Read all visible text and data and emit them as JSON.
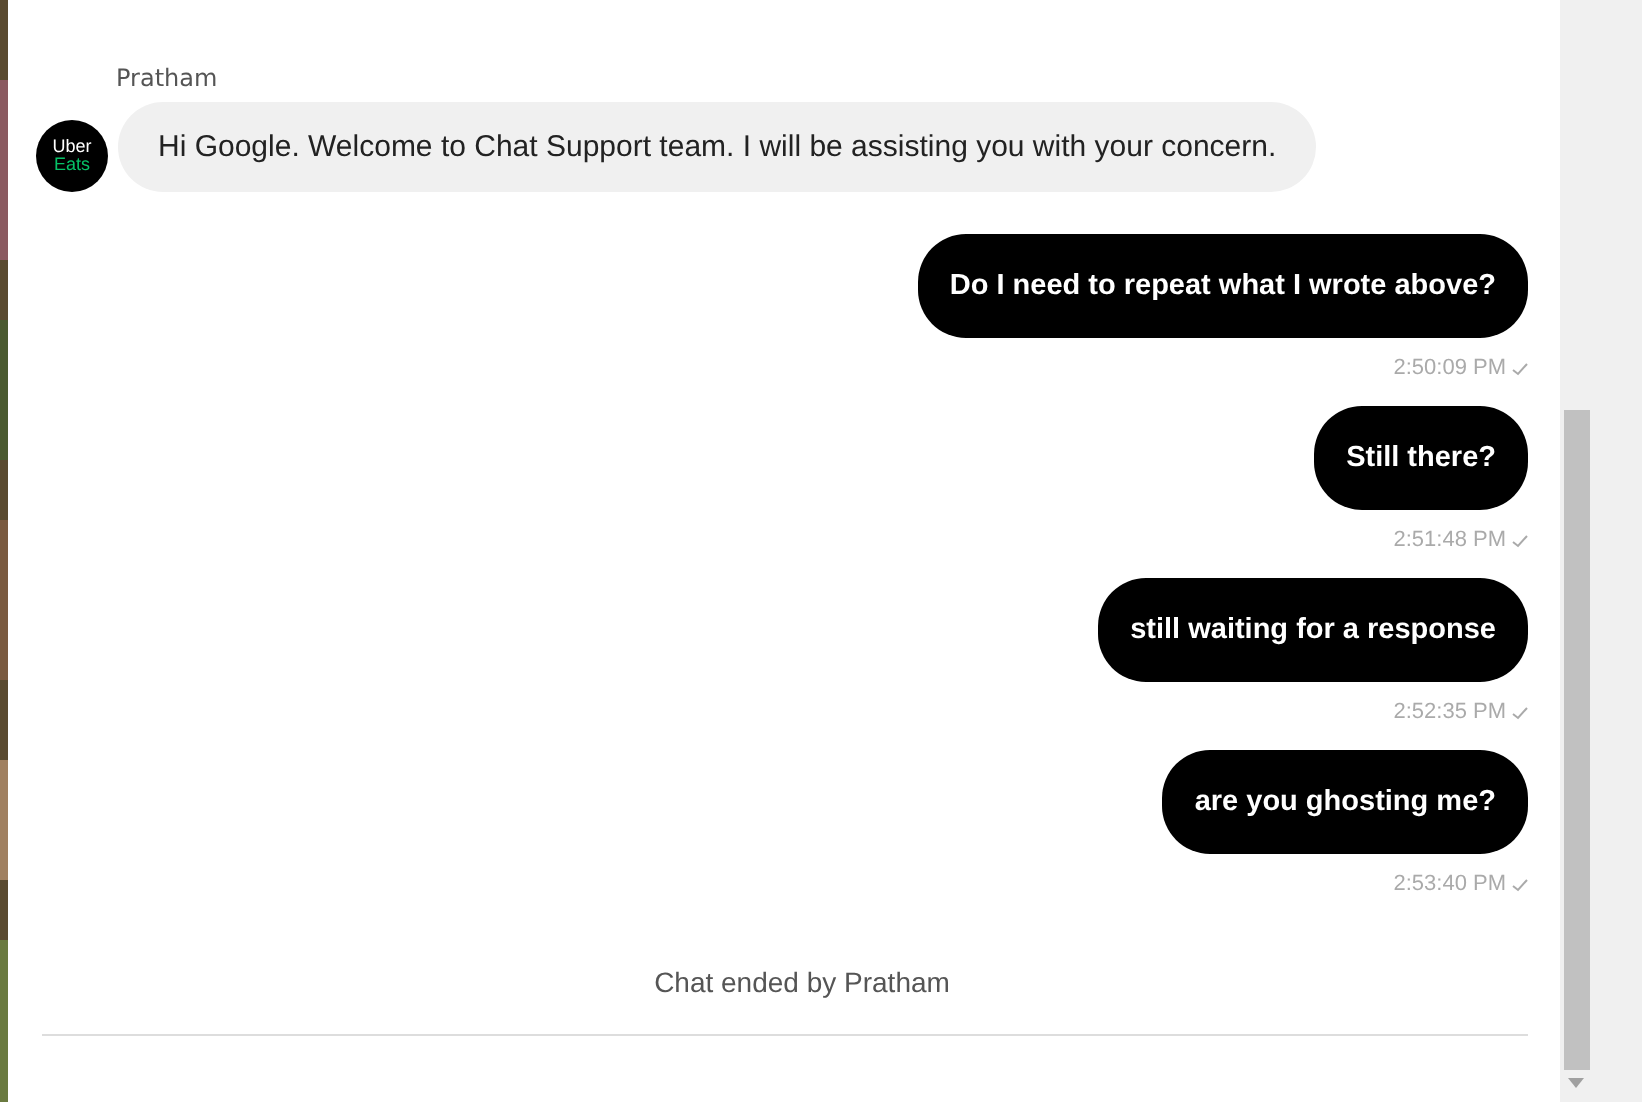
{
  "messages": [
    {
      "kind": "agent",
      "sender": "Pratham",
      "avatar": {
        "line_1": "Uber",
        "line_2": "Eats"
      },
      "text": "Hi Google. Welcome to Chat Support team. I will be assisting you with your concern."
    },
    {
      "kind": "user",
      "text": "Do I need to repeat what I wrote above?",
      "time": "2:50:09 PM"
    },
    {
      "kind": "user",
      "text": "Still there?",
      "time": "2:51:48 PM"
    },
    {
      "kind": "user",
      "text": "still waiting for a response",
      "time": "2:52:35 PM"
    },
    {
      "kind": "user",
      "text": "are you ghosting me?",
      "time": "2:53:40 PM"
    }
  ],
  "status": "Chat ended by Pratham"
}
